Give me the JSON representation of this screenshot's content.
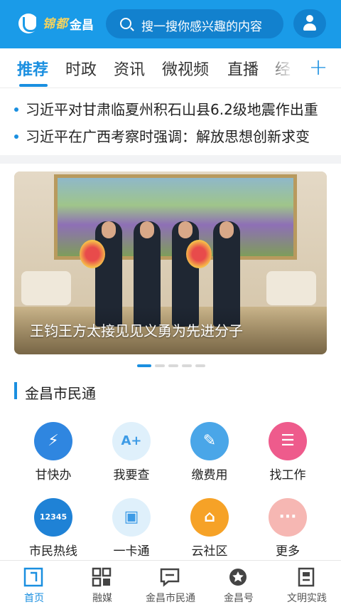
{
  "header": {
    "logo_mark": "锦都",
    "logo_name": "金昌",
    "search_placeholder": "搜一搜你感兴趣的内容",
    "user_icon": "user-icon",
    "search_icon": "search-icon"
  },
  "tabs": {
    "items": [
      {
        "label": "推荐",
        "active": true
      },
      {
        "label": "时政",
        "active": false
      },
      {
        "label": "资讯",
        "active": false
      },
      {
        "label": "微视频",
        "active": false
      },
      {
        "label": "直播",
        "active": false
      },
      {
        "label": "经",
        "active": false
      }
    ],
    "add_label": "+"
  },
  "ticker": {
    "items": [
      "习近平对甘肃临夏州积石山县6.2级地震作出重",
      "习近平在广西考察时强调：解放思想创新求变"
    ]
  },
  "banner": {
    "caption": "王钧王方太接见见义勇为先进分子",
    "slide_count": 5,
    "active_slide": 1
  },
  "section": {
    "title": "金昌市民通",
    "services": [
      {
        "label": "甘快办",
        "icon": "lightning-drop-icon",
        "color": "#2f86e0"
      },
      {
        "label": "我要查",
        "icon": "search-document-icon",
        "color": "#dff0fb"
      },
      {
        "label": "缴费用",
        "icon": "payment-card-icon",
        "color": "#4aa6e8"
      },
      {
        "label": "找工作",
        "icon": "clipboard-icon",
        "color": "#ee5b8c"
      },
      {
        "label": "市民热线",
        "icon": "hotline-12345-icon",
        "color": "#1f82d6"
      },
      {
        "label": "一卡通",
        "icon": "id-card-icon",
        "color": "#dff0fb"
      },
      {
        "label": "云社区",
        "icon": "house-icon",
        "color": "#f6a227"
      },
      {
        "label": "更多",
        "icon": "more-icon",
        "color": "#f6b7b3"
      }
    ]
  },
  "bottom_nav": {
    "items": [
      {
        "label": "首页",
        "icon": "home-icon",
        "active": true
      },
      {
        "label": "融媒",
        "icon": "grid-icon",
        "active": false
      },
      {
        "label": "金昌市民通",
        "icon": "chat-icon",
        "active": false
      },
      {
        "label": "金昌号",
        "icon": "star-badge-icon",
        "active": false
      },
      {
        "label": "文明实践",
        "icon": "document-icon",
        "active": false
      }
    ]
  },
  "colors": {
    "brand_blue": "#1a9be8",
    "accent": "#1a8fe0"
  }
}
